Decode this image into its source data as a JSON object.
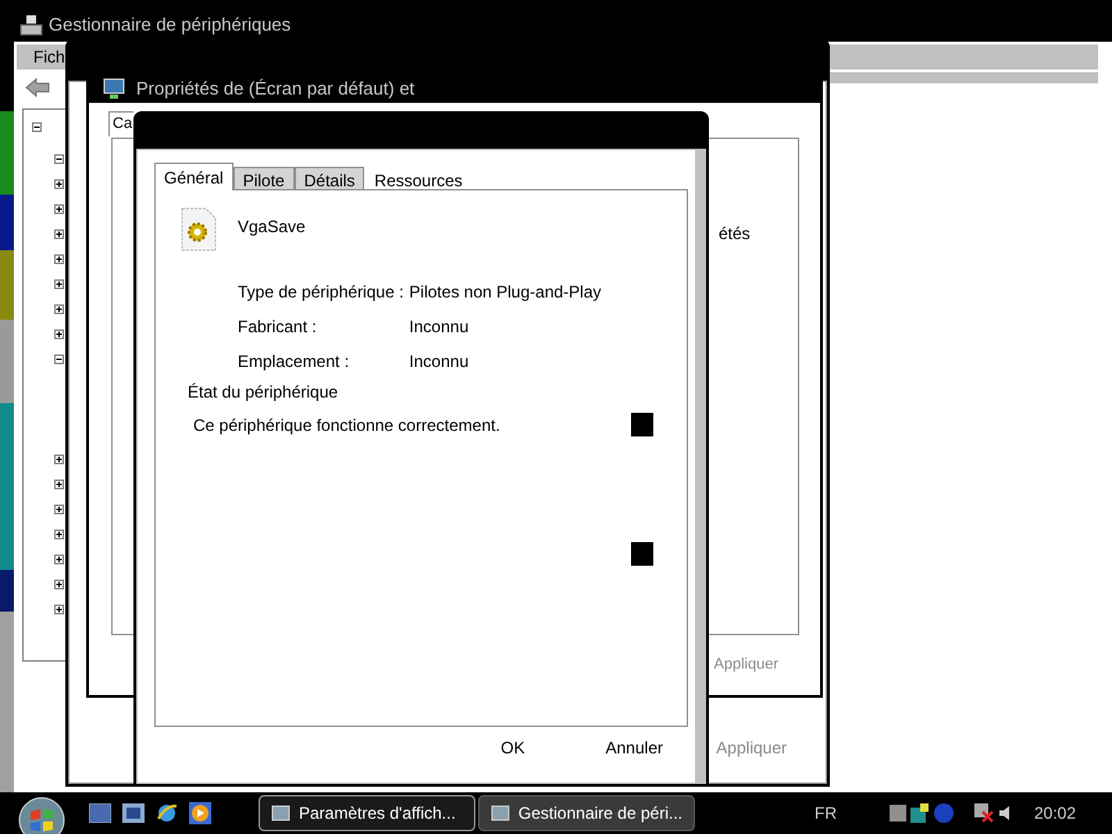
{
  "device_manager": {
    "title": "Gestionnaire de périphériques",
    "menu": [
      "Fich"
    ],
    "tree": {
      "expanded": true,
      "children": [
        {
          "expanded": true
        },
        {
          "expanded": false
        },
        {
          "expanded": false
        },
        {
          "expanded": false
        },
        {
          "expanded": false
        },
        {
          "expanded": false
        },
        {
          "expanded": false
        },
        {
          "expanded": false
        },
        {
          "expanded": true
        },
        {
          "expanded": false
        },
        {
          "expanded": false
        },
        {
          "expanded": false
        },
        {
          "expanded": false
        },
        {
          "expanded": false
        },
        {
          "expanded": false
        },
        {
          "expanded": false
        }
      ]
    }
  },
  "display_settings": {
    "buttons": [
      {
        "label": "Appliquer",
        "disabled": true
      }
    ]
  },
  "display_properties": {
    "title": "Propriétés de (Écran par défaut) et",
    "tab": "Ca",
    "partial_text": "étés",
    "buttons": [
      {
        "label": "Appliquer",
        "disabled": true
      }
    ]
  },
  "device_properties": {
    "tabs": [
      {
        "label": "Général",
        "selected": true
      },
      {
        "label": "Pilote",
        "selected": false
      },
      {
        "label": "Détails",
        "selected": false
      },
      {
        "label": "Ressources",
        "selected": false
      }
    ],
    "device_name": "VgaSave",
    "fields": [
      {
        "label": "Type de périphérique :",
        "value": "Pilotes non Plug-and-Play"
      },
      {
        "label": "Fabricant :",
        "value": "Inconnu"
      },
      {
        "label": "Emplacement :",
        "value": "Inconnu"
      }
    ],
    "status_heading": "État du périphérique",
    "status": "Ce périphérique fonctionne correctement.",
    "buttons": [
      {
        "label": "OK",
        "disabled": false
      },
      {
        "label": "Annuler",
        "disabled": false
      }
    ]
  },
  "taskbar": {
    "tasks": [
      {
        "label": "Paramètres d'affich...",
        "selected": true
      },
      {
        "label": "Gestionnaire de péri...",
        "selected": false
      }
    ],
    "language": "FR",
    "clock": "20:02"
  }
}
